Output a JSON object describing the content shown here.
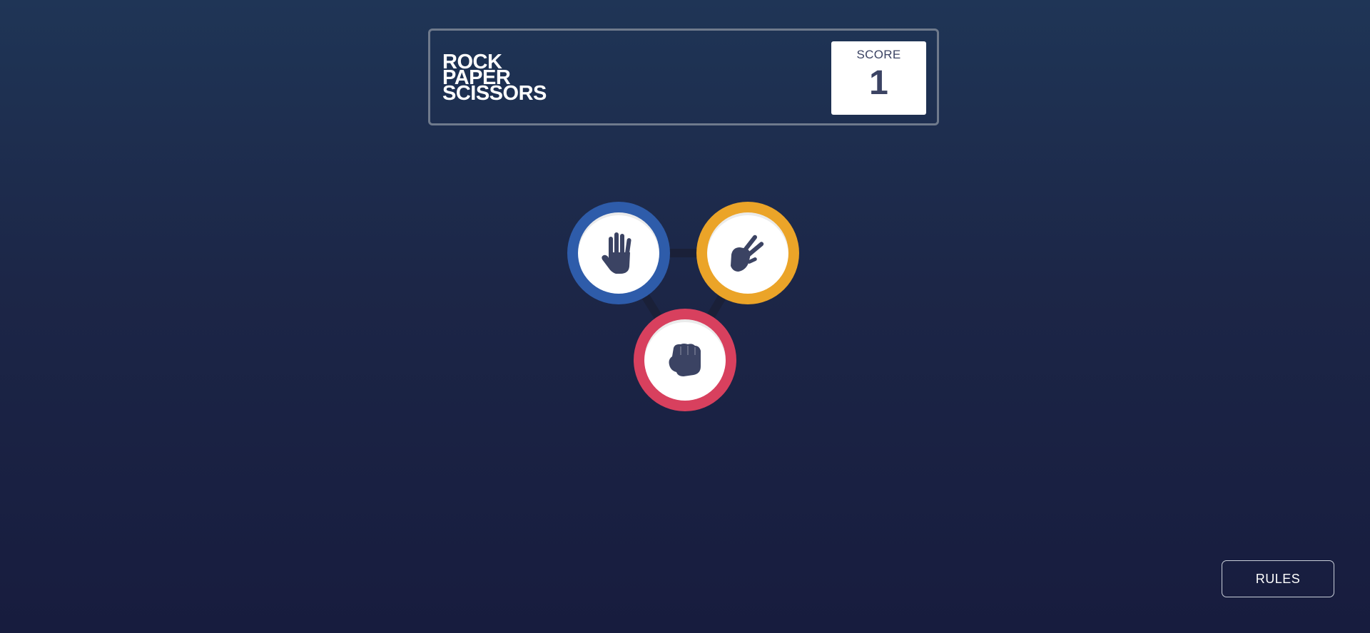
{
  "header": {
    "title_lines": [
      "ROCK",
      "PAPER",
      "SCISSORS"
    ],
    "score_label": "SCORE",
    "score_value": "1"
  },
  "tokens": [
    {
      "choice": "paper",
      "icon": "paper-hand-icon",
      "color": "#2e5caa"
    },
    {
      "choice": "scissors",
      "icon": "scissors-hand-icon",
      "color": "#eba428"
    },
    {
      "choice": "rock",
      "icon": "rock-fist-icon",
      "color": "#d8405e"
    }
  ],
  "colors": {
    "background_top": "#1f3556",
    "background_bottom": "#171c3e",
    "icon": "#3b4363",
    "header_border": "#6f7a8c"
  },
  "footer": {
    "rules_label": "RULES"
  }
}
